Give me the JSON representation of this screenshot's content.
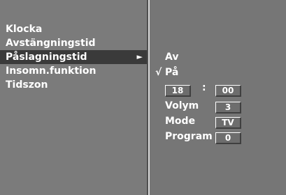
{
  "menu": {
    "items": [
      {
        "label": "Klocka"
      },
      {
        "label": "Avstängningstid"
      },
      {
        "label": "Påslagningstid",
        "selected": true
      },
      {
        "label": "Insomn.funktion"
      },
      {
        "label": "Tidszon"
      }
    ],
    "selected_arrow": "►"
  },
  "submenu": {
    "options": [
      {
        "label": "Av",
        "checked": false
      },
      {
        "label": "På",
        "checked": true
      }
    ],
    "check_mark": "√",
    "time": {
      "hour": "18",
      "separator": ":",
      "minute": "00"
    },
    "fields": [
      {
        "label": "Volym",
        "value": "3"
      },
      {
        "label": "Mode",
        "value": "TV"
      },
      {
        "label": "Program",
        "value": "0"
      }
    ]
  }
}
